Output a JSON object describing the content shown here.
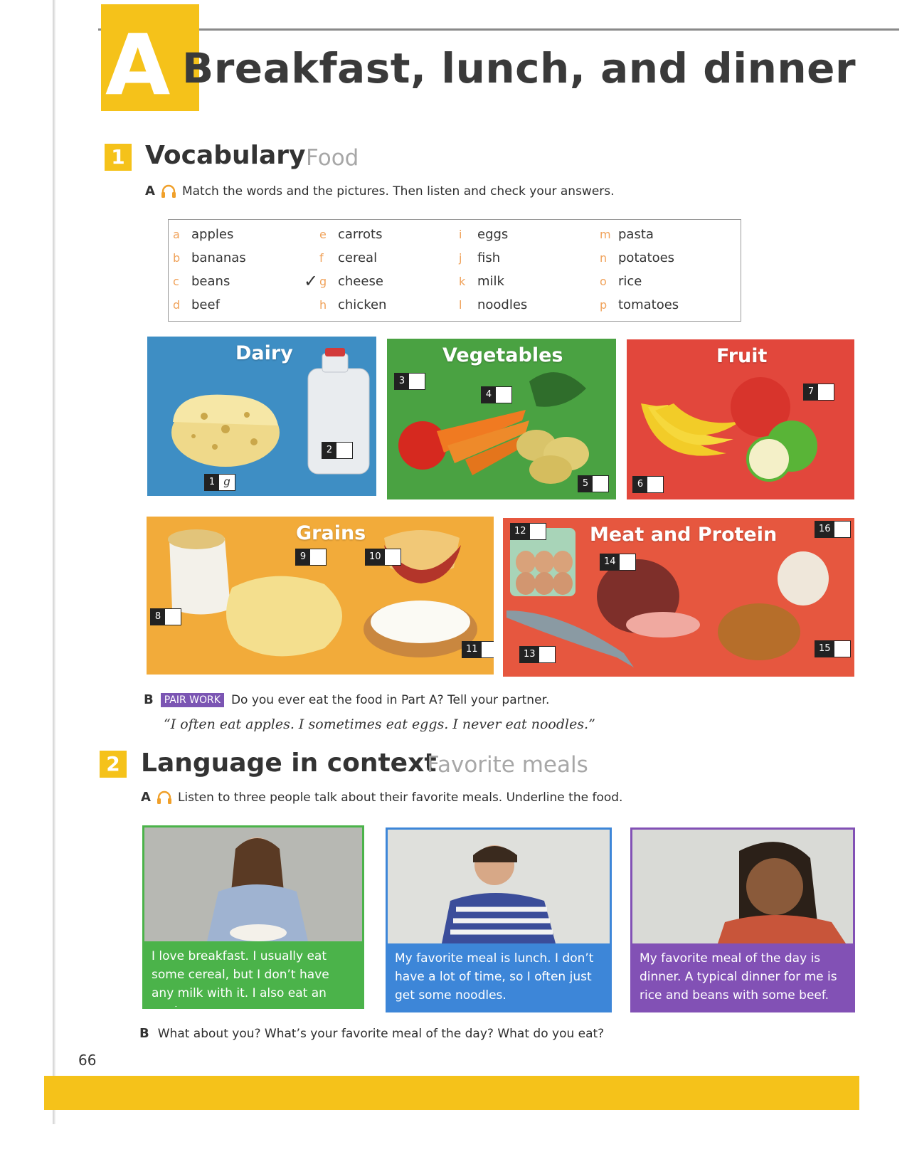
{
  "header": {
    "unit_letter": "A",
    "title": "Breakfast, lunch, and dinner"
  },
  "section1": {
    "number": "1",
    "title": "Vocabulary",
    "subtitle": "Food",
    "partA": {
      "letter": "A",
      "instruction": "Match the words and the pictures. Then listen and check your answers."
    },
    "words": [
      [
        {
          "letter": "a",
          "word": "apples"
        },
        {
          "letter": "b",
          "word": "bananas"
        },
        {
          "letter": "c",
          "word": "beans"
        },
        {
          "letter": "d",
          "word": "beef"
        }
      ],
      [
        {
          "letter": "e",
          "word": "carrots"
        },
        {
          "letter": "f",
          "word": "cereal"
        },
        {
          "letter": "g",
          "word": "cheese"
        },
        {
          "letter": "h",
          "word": "chicken"
        }
      ],
      [
        {
          "letter": "i",
          "word": "eggs"
        },
        {
          "letter": "j",
          "word": "fish"
        },
        {
          "letter": "k",
          "word": "milk"
        },
        {
          "letter": "l",
          "word": "noodles"
        }
      ],
      [
        {
          "letter": "m",
          "word": "pasta"
        },
        {
          "letter": "n",
          "word": "potatoes"
        },
        {
          "letter": "o",
          "word": "rice"
        },
        {
          "letter": "p",
          "word": "tomatoes"
        }
      ]
    ],
    "check_mark": "✓",
    "panels": {
      "dairy": {
        "title": "Dairy",
        "color": "#3e8ec4"
      },
      "vegetables": {
        "title": "Vegetables",
        "color": "#4aa242"
      },
      "fruit": {
        "title": "Fruit",
        "color": "#e2473c"
      },
      "grains": {
        "title": "Grains",
        "color": "#f2ab3a"
      },
      "meat": {
        "title": "Meat and Protein",
        "color": "#e6573f"
      }
    },
    "boxes": {
      "b1": {
        "num": "1",
        "answer": "g"
      },
      "b2": {
        "num": "2",
        "answer": ""
      },
      "b3": {
        "num": "3",
        "answer": ""
      },
      "b4": {
        "num": "4",
        "answer": ""
      },
      "b5": {
        "num": "5",
        "answer": ""
      },
      "b6": {
        "num": "6",
        "answer": ""
      },
      "b7": {
        "num": "7",
        "answer": ""
      },
      "b8": {
        "num": "8",
        "answer": ""
      },
      "b9": {
        "num": "9",
        "answer": ""
      },
      "b10": {
        "num": "10",
        "answer": ""
      },
      "b11": {
        "num": "11",
        "answer": ""
      },
      "b12": {
        "num": "12",
        "answer": ""
      },
      "b13": {
        "num": "13",
        "answer": ""
      },
      "b14": {
        "num": "14",
        "answer": ""
      },
      "b15": {
        "num": "15",
        "answer": ""
      },
      "b16": {
        "num": "16",
        "answer": ""
      }
    },
    "partB": {
      "letter": "B",
      "tag": "PAIR WORK",
      "instruction": "Do you ever eat the food in Part A? Tell your partner.",
      "example": "“I often eat apples. I sometimes eat eggs. I never eat noodles.”"
    }
  },
  "section2": {
    "number": "2",
    "title": "Language in context",
    "subtitle": "Favorite meals",
    "partA": {
      "letter": "A",
      "instruction": "Listen to three people talk about their favorite meals. Underline the food."
    },
    "cards": [
      {
        "text": "I love breakfast. I usually eat some cereal, but I don’t have any milk with it. I also eat an apple.",
        "color": "#4bb34a"
      },
      {
        "text": "My favorite meal is lunch. I don’t have a lot of time, so I often just get some noodles.",
        "color": "#3d86d8"
      },
      {
        "text": "My favorite meal of the day is dinner. A typical dinner for me is rice and beans with some beef.",
        "color": "#8251b5"
      }
    ],
    "partB": {
      "letter": "B",
      "instruction": "What about you? What’s your favorite meal of the day? What do you eat?"
    }
  },
  "footer": {
    "page_number": "66"
  },
  "colors": {
    "accent": "#f5c21a",
    "word_letter": "#f0a25a",
    "pair_work": "#7b55b3"
  }
}
